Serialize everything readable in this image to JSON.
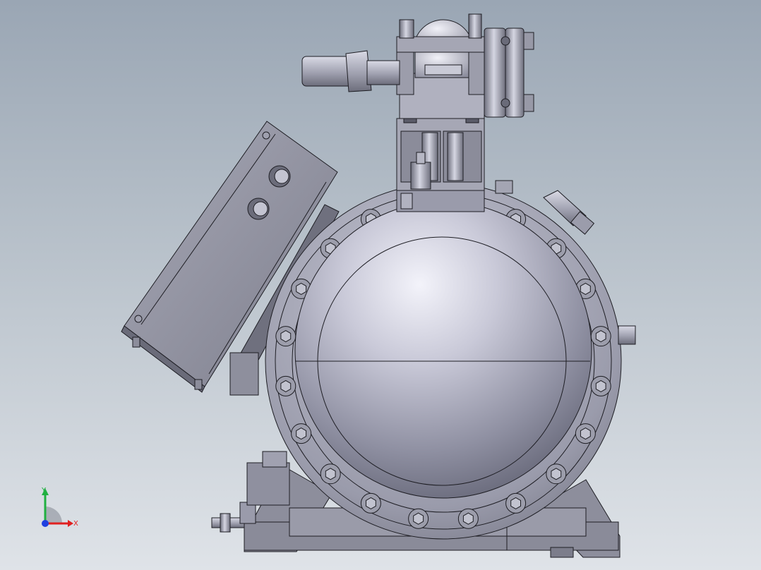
{
  "app": {
    "view": "Front"
  },
  "triad": {
    "x_label": "X",
    "y_label": "Y",
    "x_color": "#e02020",
    "y_color": "#20b040",
    "z_color": "#2040e0"
  },
  "colors": {
    "background_top": "#9aa6b4",
    "background_bottom": "#dfe3e8",
    "body_light": "#e6e6f0",
    "body_mid": "#a9aab8",
    "body_dark": "#5f6070",
    "edge": "#1e1e24"
  },
  "model": {
    "name_icon": "compressor-model",
    "bolt_count": 20
  }
}
